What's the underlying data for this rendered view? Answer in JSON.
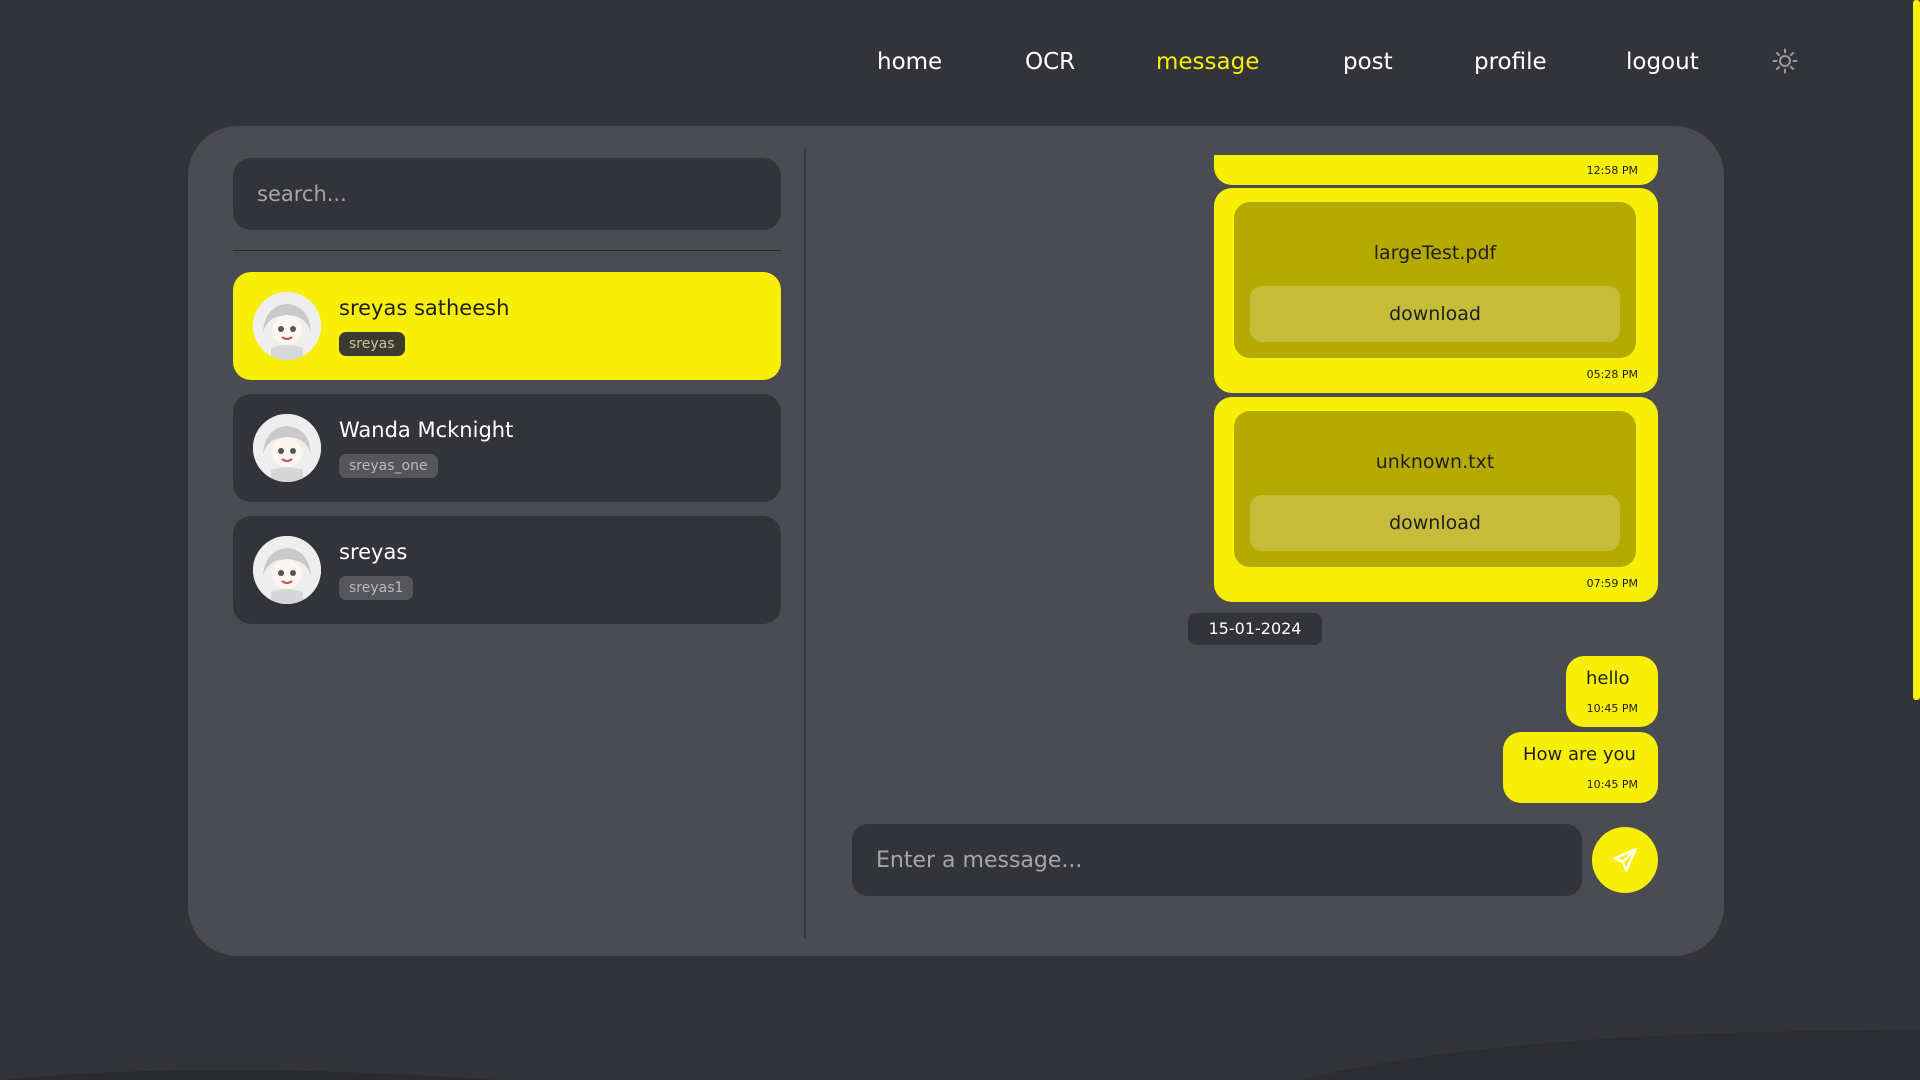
{
  "nav": {
    "items": [
      {
        "label": "home",
        "active": false
      },
      {
        "label": "OCR",
        "active": false
      },
      {
        "label": "message",
        "active": true
      },
      {
        "label": "post",
        "active": false
      },
      {
        "label": "profile",
        "active": false
      },
      {
        "label": "logout",
        "active": false
      }
    ],
    "theme_icon": "sun-icon"
  },
  "sidebar": {
    "search_placeholder": "search...",
    "contacts": [
      {
        "name": "sreyas satheesh",
        "username": "sreyas",
        "selected": true
      },
      {
        "name": "Wanda Mcknight",
        "username": "sreyas_one",
        "selected": false
      },
      {
        "name": "sreyas",
        "username": "sreyas1",
        "selected": false
      }
    ]
  },
  "chat": {
    "messages": [
      {
        "type": "partial",
        "time": "12:58 PM"
      },
      {
        "type": "file",
        "file_name": "largeTest.pdf",
        "button": "download",
        "time": "05:28 PM"
      },
      {
        "type": "file",
        "file_name": "unknown.txt",
        "button": "download",
        "time": "07:59 PM"
      },
      {
        "type": "text",
        "text": "hello",
        "time": "10:45 PM"
      },
      {
        "type": "text",
        "text": "How are you",
        "time": "10:45 PM"
      }
    ],
    "date_separator": "15-01-2024",
    "input_placeholder": "Enter a message...",
    "send_icon": "send-icon"
  },
  "colors": {
    "background": "#333439",
    "card": "#4b4c52",
    "accent": "#f7ef07",
    "file_box": "#b5ab00"
  }
}
